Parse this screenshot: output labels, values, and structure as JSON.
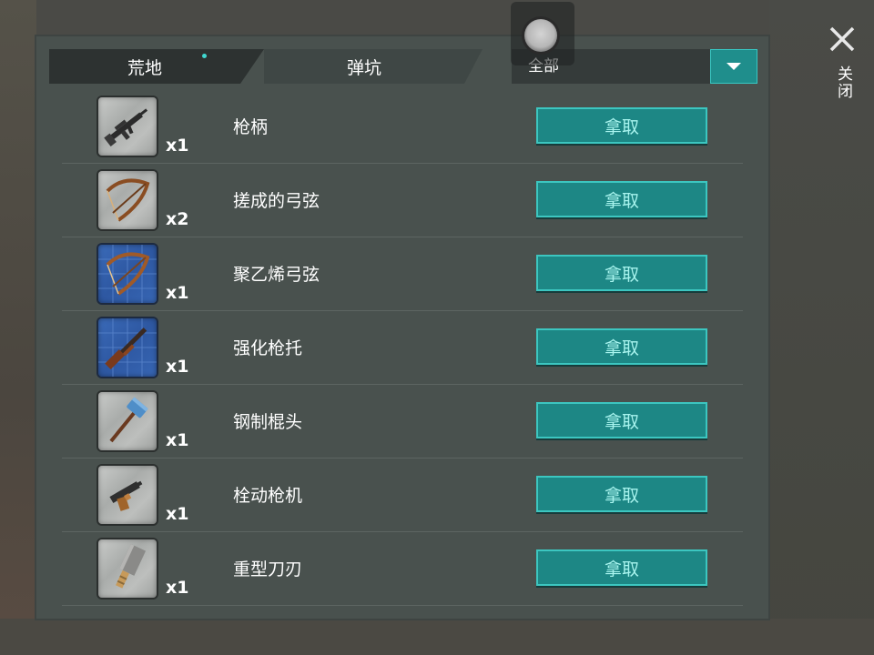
{
  "tabs": {
    "active": "荒地",
    "inactive": "弹坑"
  },
  "filter": {
    "selected": "全部"
  },
  "close": {
    "label": "关闭"
  },
  "items": [
    {
      "name": "枪柄",
      "qty": "x1",
      "icon": "assault-rifle-icon",
      "blueprint": false,
      "action": "拿取"
    },
    {
      "name": "搓成的弓弦",
      "qty": "x2",
      "icon": "bow-icon",
      "blueprint": false,
      "action": "拿取"
    },
    {
      "name": "聚乙烯弓弦",
      "qty": "x1",
      "icon": "bow-blueprint-icon",
      "blueprint": true,
      "action": "拿取"
    },
    {
      "name": "强化枪托",
      "qty": "x1",
      "icon": "shotgun-blueprint-icon",
      "blueprint": true,
      "action": "拿取"
    },
    {
      "name": "钢制棍头",
      "qty": "x1",
      "icon": "hammer-icon",
      "blueprint": false,
      "action": "拿取"
    },
    {
      "name": "栓动枪机",
      "qty": "x1",
      "icon": "pistol-icon",
      "blueprint": false,
      "action": "拿取"
    },
    {
      "name": "重型刀刃",
      "qty": "x1",
      "icon": "cleaver-icon",
      "blueprint": false,
      "action": "拿取"
    }
  ],
  "colors": {
    "accent": "#1d8785",
    "accent_border": "#3cc6c0",
    "panel": "#49514e",
    "blueprint": "#2e58a2"
  }
}
